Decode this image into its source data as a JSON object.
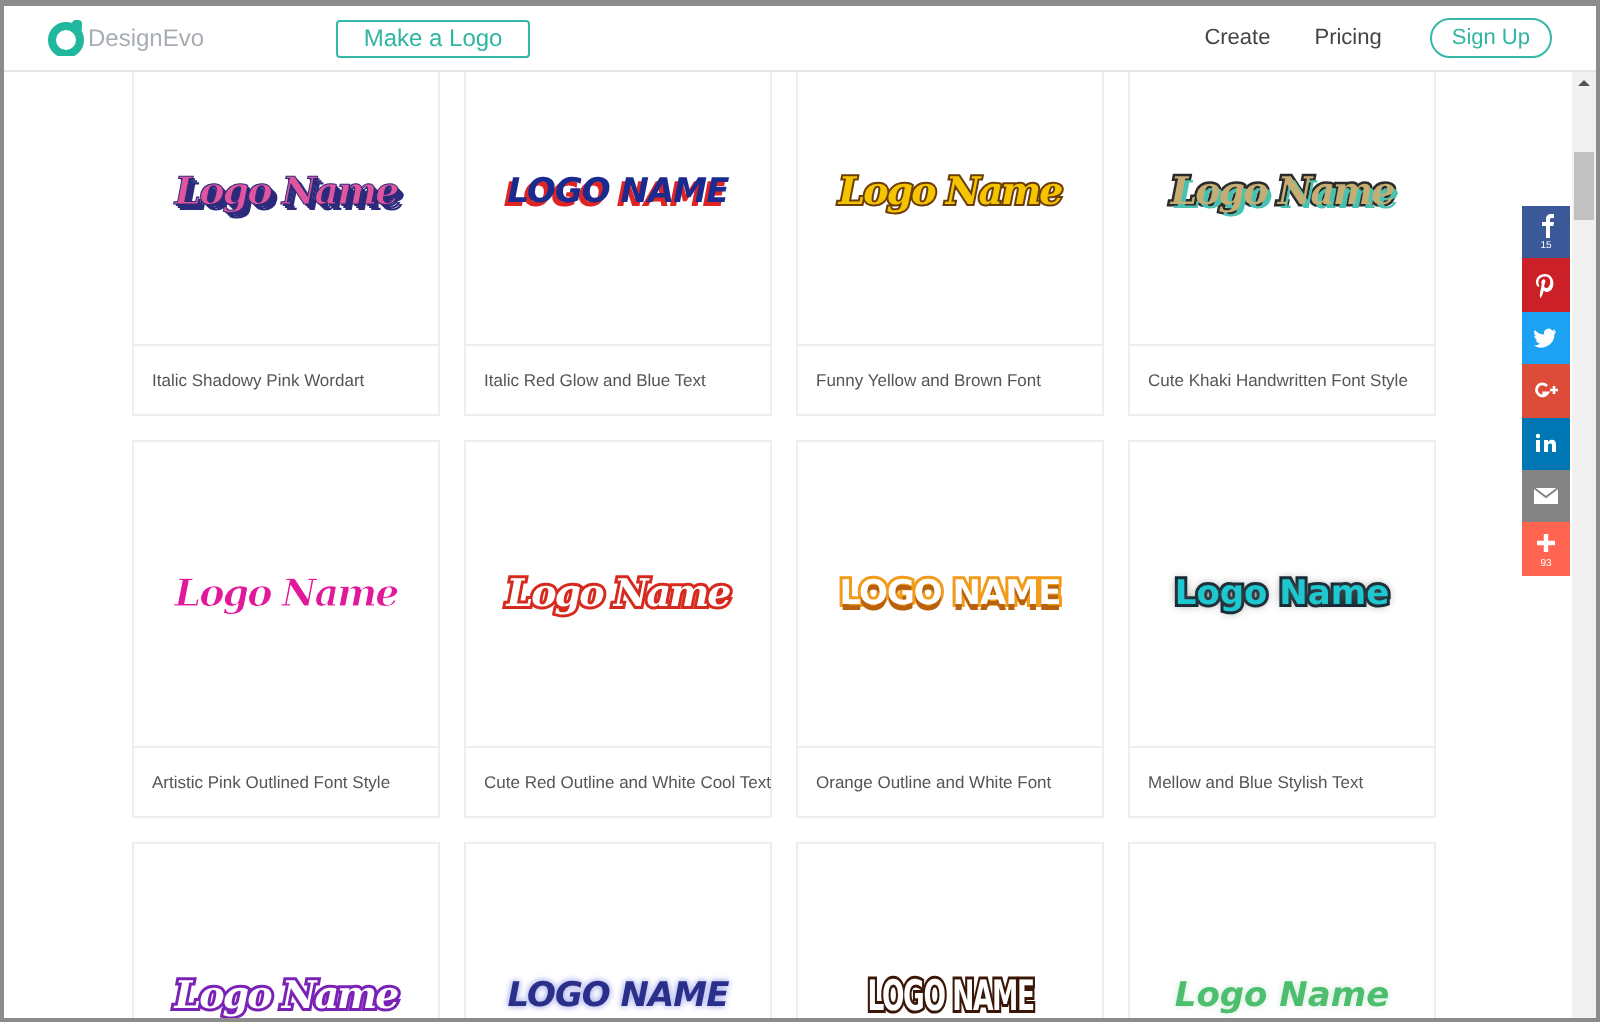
{
  "header": {
    "brand": "DesignEvo",
    "cta": "Make a Logo",
    "nav": [
      "Create",
      "Pricing"
    ],
    "signup": "Sign Up"
  },
  "cards": [
    {
      "preview": "Logo Name",
      "kind": "pink-shadow",
      "color": "#e0559e",
      "caption": "Italic Shadowy Pink Wordart"
    },
    {
      "preview": "LOGO NAME",
      "kind": "blue-redglow",
      "color": "#1b2a8f",
      "caption": "Italic Red Glow and Blue Text"
    },
    {
      "preview": "Logo Name",
      "kind": "yellow-brown",
      "color": "#f5c400",
      "caption": "Funny Yellow and Brown Font"
    },
    {
      "preview": "Logo Name",
      "kind": "khaki-hand",
      "color": "#c4ae74",
      "caption": "Cute Khaki Handwritten Font Style"
    },
    {
      "preview": "Logo Name",
      "kind": "pink-outline",
      "color": "#e0199a",
      "caption": "Artistic Pink Outlined Font Style"
    },
    {
      "preview": "Logo Name",
      "kind": "red-outline",
      "color": "#ffffff",
      "caption": "Cute Red Outline and White Cool Text"
    },
    {
      "preview": "LOGO NAME",
      "kind": "orange-outline",
      "color": "#ffffff",
      "caption": "Orange Outline and White Font"
    },
    {
      "preview": "Logo Name",
      "kind": "mellow-blue",
      "color": "#1ec8d0",
      "caption": "Mellow and Blue Stylish Text"
    },
    {
      "preview": "Logo Name",
      "kind": "purple-outline",
      "color": "#ffffff"
    },
    {
      "preview": "LOGO NAME",
      "kind": "navy-glow",
      "color": "#2a2f8a"
    },
    {
      "preview": "LOGO NAME",
      "kind": "brown-condensed",
      "color": "#ffffff"
    },
    {
      "preview": "Logo Name",
      "kind": "green-glow",
      "color": "#4dbd6e"
    }
  ],
  "share": [
    {
      "kind": "facebook",
      "count": "15"
    },
    {
      "kind": "pinterest"
    },
    {
      "kind": "twitter"
    },
    {
      "kind": "googleplus"
    },
    {
      "kind": "linkedin"
    },
    {
      "kind": "email"
    },
    {
      "kind": "more",
      "count": "93"
    }
  ]
}
